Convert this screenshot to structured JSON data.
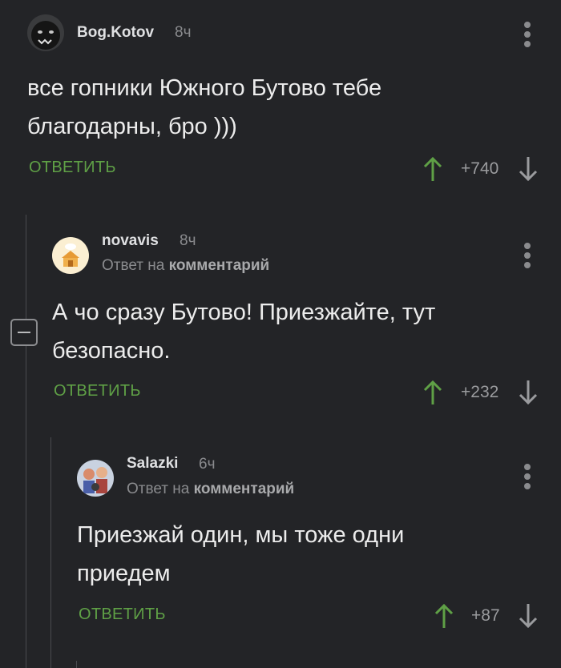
{
  "comments": [
    {
      "author": "Bog.Kotov",
      "time": "8ч",
      "text_line1": "все гопники Южного Бутово тебе",
      "text_line2": "благодарны, бро )))",
      "reply_label": "ОТВЕТИТЬ",
      "rating": "+740",
      "avatar_icon": "dark-beast-avatar"
    },
    {
      "author": "novavis",
      "time": "8ч",
      "reply_prefix": "Ответ на",
      "reply_target": "комментарий",
      "text_line1": "А чо сразу Бутово! Приезжайте, тут",
      "text_line2": "безопасно.",
      "reply_label": "ОТВЕТИТЬ",
      "rating": "+232",
      "avatar_icon": "orange-house-avatar"
    },
    {
      "author": "Salazki",
      "time": "6ч",
      "reply_prefix": "Ответ на",
      "reply_target": "комментарий",
      "text_line1": "Приезжай один, мы тоже одни",
      "text_line2": "приедем",
      "reply_label": "ОТВЕТИТЬ",
      "rating": "+87",
      "avatar_icon": "cartoon-group-avatar"
    }
  ],
  "colors": {
    "accent_green": "#5fa046",
    "background": "#232427",
    "muted": "#8a8b8e"
  }
}
